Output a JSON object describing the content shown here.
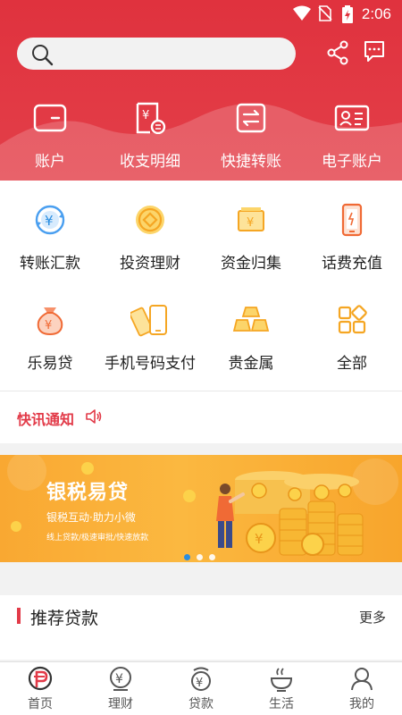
{
  "status_bar": {
    "time": "2:06"
  },
  "search": {
    "placeholder": ""
  },
  "header_icons": [
    "share-icon",
    "message-icon"
  ],
  "top_services": [
    {
      "label": "账户",
      "icon": "wallet-icon"
    },
    {
      "label": "收支明细",
      "icon": "bill-icon"
    },
    {
      "label": "快捷转账",
      "icon": "transfer-icon"
    },
    {
      "label": "电子账户",
      "icon": "id-card-icon"
    }
  ],
  "services": [
    {
      "label": "转账汇款",
      "icon": "yen-exchange-icon"
    },
    {
      "label": "投资理财",
      "icon": "coin-icon"
    },
    {
      "label": "资金归集",
      "icon": "cash-stack-icon"
    },
    {
      "label": "话费充值",
      "icon": "phone-icon"
    },
    {
      "label": "乐易贷",
      "icon": "money-bag-icon"
    },
    {
      "label": "手机号码支付",
      "icon": "mobile-pay-icon"
    },
    {
      "label": "贵金属",
      "icon": "gold-bar-icon"
    },
    {
      "label": "全部",
      "icon": "grid-icon"
    }
  ],
  "notice": {
    "title": "快讯通知"
  },
  "banner": {
    "title": "银税易贷",
    "subtitle": "银税互动·助力小微",
    "tags": "线上贷款/极速审批/快速放款",
    "active_slide": 1,
    "slide_count": 3
  },
  "recommend": {
    "title": "推荐贷款",
    "more": "更多"
  },
  "tabs": [
    {
      "label": "首页",
      "icon": "home-icon",
      "active": true
    },
    {
      "label": "理财",
      "icon": "finance-icon",
      "active": false
    },
    {
      "label": "贷款",
      "icon": "loan-icon",
      "active": false
    },
    {
      "label": "生活",
      "icon": "life-icon",
      "active": false
    },
    {
      "label": "我的",
      "icon": "user-icon",
      "active": false
    }
  ],
  "colors": {
    "brand_red": "#e0323e",
    "accent_orange": "#f9a832",
    "blue_dot": "#2a8de0"
  }
}
